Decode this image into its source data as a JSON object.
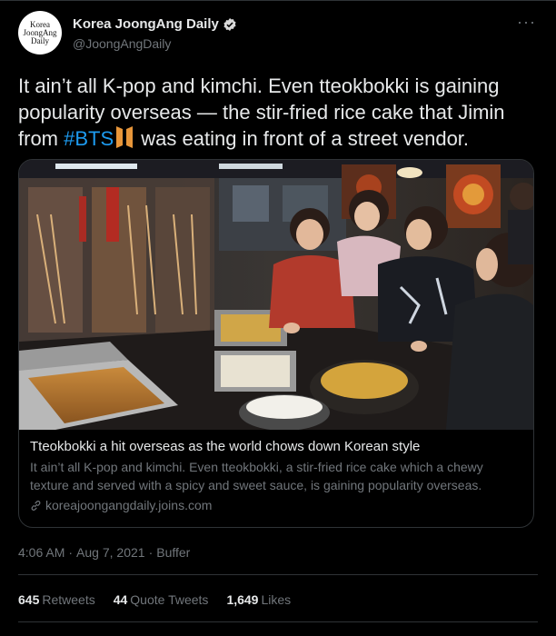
{
  "account": {
    "avatar_text": [
      "Korea",
      "JoongAng",
      "Daily"
    ],
    "display_name": "Korea JoongAng Daily",
    "handle": "@JoongAngDaily",
    "verified": true
  },
  "tweet": {
    "text_part1": "It ain’t all K-pop and kimchi. Even tteokbokki is gaining popularity overseas —  the stir-fried rice cake that Jimin from ",
    "hashtag": "#BTS",
    "text_part2": " was eating in front of a street vendor."
  },
  "card": {
    "image_icon": "street-food-stall-photo",
    "title": "Tteokbokki a hit overseas as the world chows down Korean style",
    "description": "It ain’t all K-pop and kimchi. Even tteokbokki, a stir-fried rice cake which a chewy texture and served with a spicy and sweet sauce, is gaining popularity overseas.",
    "domain": "koreajoongangdaily.joins.com"
  },
  "meta": {
    "time": "4:06 AM",
    "date": "Aug 7, 2021",
    "source": "Buffer"
  },
  "stats": {
    "retweets_count": "645",
    "retweets_label": "Retweets",
    "quotes_count": "44",
    "quotes_label": "Quote Tweets",
    "likes_count": "1,649",
    "likes_label": "Likes"
  },
  "colors": {
    "background": "#000000",
    "text_primary": "#e7e9ea",
    "text_secondary": "#71767b",
    "link": "#1d9bf0",
    "border": "#2f3336",
    "bts_emoji": "#e8963a"
  }
}
